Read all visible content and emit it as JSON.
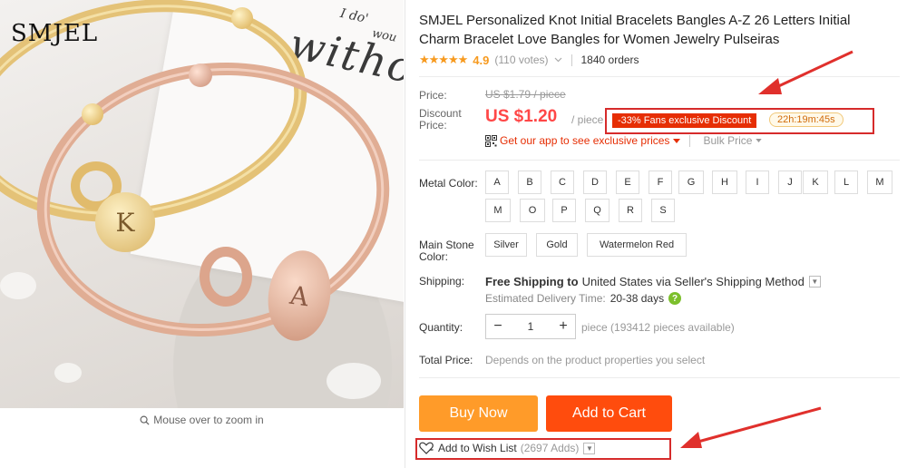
{
  "product": {
    "logo": "SMJEL",
    "paper_text_1": "I do'",
    "paper_text_2": "without",
    "paper_text_3": "wou",
    "charm_letter_1": "K",
    "charm_letter_2": "A",
    "zoom_hint": "Mouse over to zoom in"
  },
  "details": {
    "title": "SMJEL Personalized Knot Initial Bracelets Bangles A-Z 26 Letters Initial Charm Bracelet Love Bangles for Women Jewelry Pulseiras",
    "stars": "★★★★★",
    "rating": "4.9",
    "votes": "(110 votes)",
    "orders": "1840 orders"
  },
  "pricing": {
    "price_label": "Price:",
    "original_price": "US $1.79 / piece",
    "discount_label_1": "Discount",
    "discount_label_2": "Price:",
    "discount_price": "US $1.20",
    "per_unit": "/ piece",
    "fans_badge": "-33% Fans exclusive Discount",
    "timer": "22h:19m:45s",
    "app_link": "Get our app to see exclusive prices",
    "bulk_price": "Bulk Price"
  },
  "options": {
    "metal_label": "Metal Color:",
    "metal_colors": [
      "A",
      "B",
      "C",
      "D",
      "E",
      "F",
      "G",
      "H",
      "I",
      "J",
      "K",
      "L",
      "M",
      "M",
      "O",
      "P",
      "Q",
      "R",
      "S"
    ],
    "stone_label_1": "Main Stone",
    "stone_label_2": "Color:",
    "stone_colors": [
      "Silver",
      "Gold",
      "Watermelon Red"
    ]
  },
  "shipping": {
    "label": "Shipping:",
    "free": "Free Shipping to",
    "destination": "United States via Seller's Shipping Method",
    "estimated_label": "Estimated Delivery Time:",
    "estimated_days": "20-38 days"
  },
  "quantity": {
    "label": "Quantity:",
    "minus": "−",
    "value": "1",
    "plus": "+",
    "available": "piece (193412 pieces available)"
  },
  "total": {
    "label": "Total Price:",
    "note": "Depends on the product properties you select"
  },
  "actions": {
    "buy_now": "Buy Now",
    "add_to_cart": "Add to Cart",
    "wish_list": "Add to Wish List",
    "wish_count": "(2697 Adds)"
  },
  "colors": {
    "price_red": "#ff4747",
    "buy_now_orange": "#ff9b29",
    "cart_orange": "#ff4c0d",
    "badge_red": "#e62e04",
    "annotation_red": "#d62b2b",
    "star_orange": "#f79a1f"
  }
}
